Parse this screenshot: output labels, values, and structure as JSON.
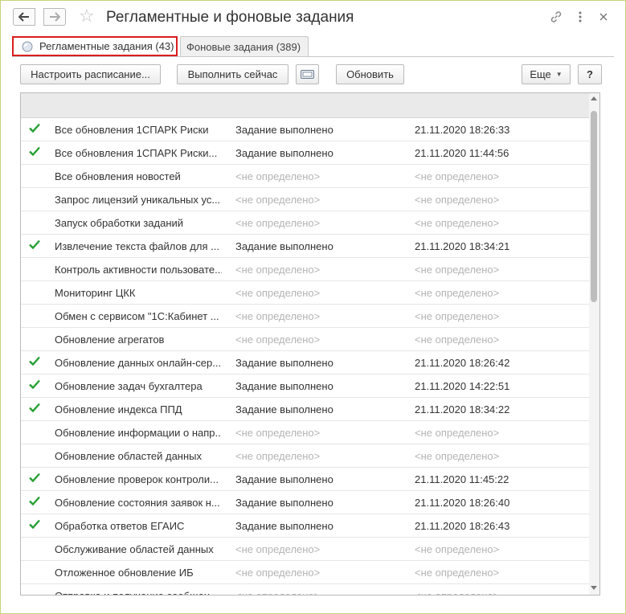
{
  "window": {
    "title": "Регламентные и фоновые задания"
  },
  "tabs": [
    {
      "label": "Регламентные задания (43)",
      "active": true
    },
    {
      "label": "Фоновые задания (389)",
      "active": false
    }
  ],
  "toolbar": {
    "schedule_label": "Настроить расписание...",
    "run_now_label": "Выполнить сейчас",
    "refresh_label": "Обновить",
    "more_label": "Еще",
    "help_label": "?"
  },
  "colors": {
    "active_tab_border": "#d91e1e",
    "check": "#27a035",
    "undefined_text": "#b4b4b4"
  },
  "rows": [
    {
      "done": true,
      "name": "Все обновления 1СПАРК Риски",
      "status": "Задание выполнено",
      "date": "21.11.2020 18:26:33"
    },
    {
      "done": true,
      "name": "Все обновления 1СПАРК Риски...",
      "status": "Задание выполнено",
      "date": "21.11.2020 11:44:56"
    },
    {
      "done": false,
      "name": "Все обновления новостей",
      "status": "<не определено>",
      "date": "<не определено>"
    },
    {
      "done": false,
      "name": "Запрос лицензий уникальных ус...",
      "status": "<не определено>",
      "date": "<не определено>"
    },
    {
      "done": false,
      "name": "Запуск обработки заданий",
      "status": "<не определено>",
      "date": "<не определено>"
    },
    {
      "done": true,
      "name": "Извлечение текста файлов для ...",
      "status": "Задание выполнено",
      "date": "21.11.2020 18:34:21"
    },
    {
      "done": false,
      "name": "Контроль активности пользовате...",
      "status": "<не определено>",
      "date": "<не определено>"
    },
    {
      "done": false,
      "name": "Мониторинг ЦКК",
      "status": "<не определено>",
      "date": "<не определено>"
    },
    {
      "done": false,
      "name": "Обмен с сервисом \"1С:Кабинет ...",
      "status": "<не определено>",
      "date": "<не определено>"
    },
    {
      "done": false,
      "name": "Обновление агрегатов",
      "status": "<не определено>",
      "date": "<не определено>"
    },
    {
      "done": true,
      "name": "Обновление данных онлайн-сер...",
      "status": "Задание выполнено",
      "date": "21.11.2020 18:26:42"
    },
    {
      "done": true,
      "name": "Обновление задач бухгалтера",
      "status": "Задание выполнено",
      "date": "21.11.2020 14:22:51"
    },
    {
      "done": true,
      "name": "Обновление индекса ППД",
      "status": "Задание выполнено",
      "date": "21.11.2020 18:34:22"
    },
    {
      "done": false,
      "name": "Обновление информации о напр...",
      "status": "<не определено>",
      "date": "<не определено>"
    },
    {
      "done": false,
      "name": "Обновление областей данных",
      "status": "<не определено>",
      "date": "<не определено>"
    },
    {
      "done": true,
      "name": "Обновление проверок контроли...",
      "status": "Задание выполнено",
      "date": "21.11.2020 11:45:22"
    },
    {
      "done": true,
      "name": "Обновление состояния заявок н...",
      "status": "Задание выполнено",
      "date": "21.11.2020 18:26:40"
    },
    {
      "done": true,
      "name": "Обработка ответов ЕГАИС",
      "status": "Задание выполнено",
      "date": "21.11.2020 18:26:43"
    },
    {
      "done": false,
      "name": "Обслуживание областей данных",
      "status": "<не определено>",
      "date": "<не определено>"
    },
    {
      "done": false,
      "name": "Отложенное обновление ИБ",
      "status": "<не определено>",
      "date": "<не определено>"
    },
    {
      "done": false,
      "name": "Отправка и получение сообщен...",
      "status": "<не определено>",
      "date": "<не определено>"
    }
  ]
}
